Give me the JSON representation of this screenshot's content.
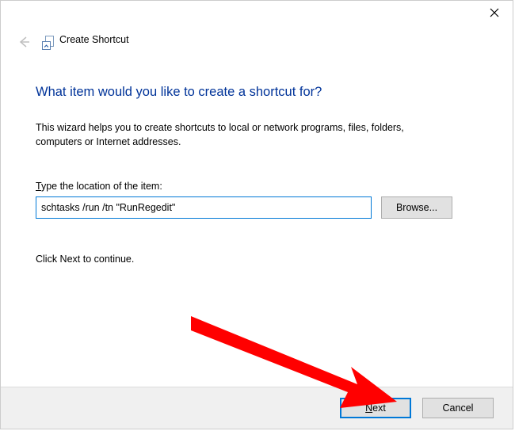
{
  "window": {
    "title": "Create Shortcut"
  },
  "page": {
    "heading": "What item would you like to create a shortcut for?",
    "intro": "This wizard helps you to create shortcuts to local or network programs, files, folders, computers or Internet addresses.",
    "location_label_prefix_underlined": "T",
    "location_label_rest": "ype the location of the item:",
    "location_value": "schtasks /run /tn \"RunRegedit\"",
    "browse_label": "Browse...",
    "hint": "Click Next to continue."
  },
  "footer": {
    "next_underlined": "N",
    "next_rest": "ext",
    "cancel": "Cancel"
  }
}
